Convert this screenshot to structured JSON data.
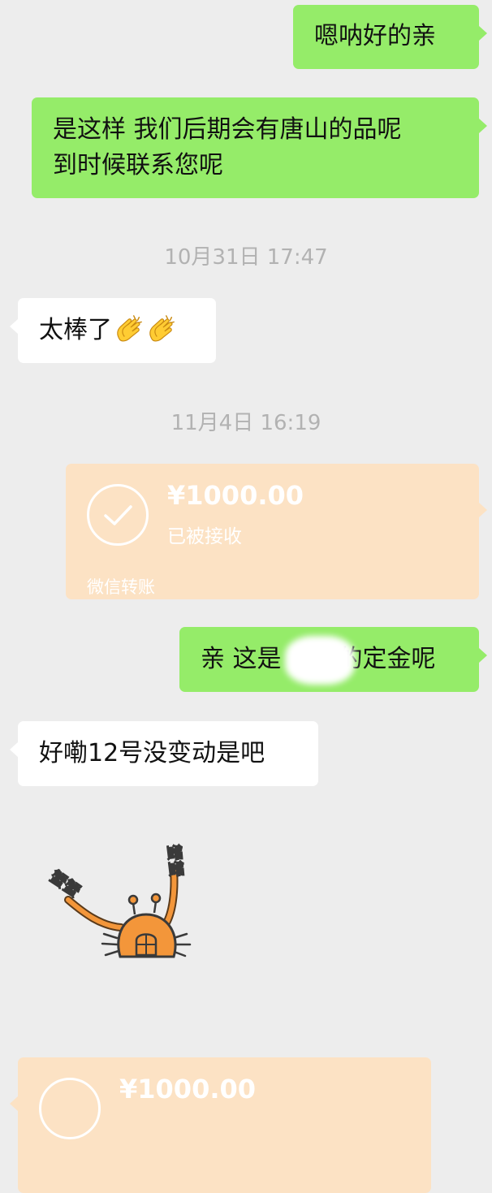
{
  "messages": {
    "m1": {
      "text": "嗯呐好的亲"
    },
    "m2": {
      "line1": "是这样 我们后期会有唐山的品呢",
      "line2": "到时候联系您呢"
    },
    "time1": "10月31日 17:47",
    "m3": {
      "text": "太棒了",
      "emoji": [
        "clapping-hands",
        "clapping-hands"
      ]
    },
    "time2": "11月4日 16:19",
    "transfer1": {
      "amount": "¥1000.00",
      "status": "已被接收",
      "label": "微信转账"
    },
    "m4": {
      "prefix": "亲 这是",
      "suffix": "的定金呢"
    },
    "m5": {
      "text": "好嘞12号没变动是吧"
    },
    "sticker": {
      "name": "crab-sticker",
      "text": "蟹蟹"
    },
    "transfer2": {
      "amount": "¥1000.00"
    }
  },
  "colors": {
    "background": "#ededed",
    "outgoing": "#95ec69",
    "incoming": "#ffffff",
    "transfer": "#fce2c4",
    "timestamp": "#b2b2b2"
  }
}
